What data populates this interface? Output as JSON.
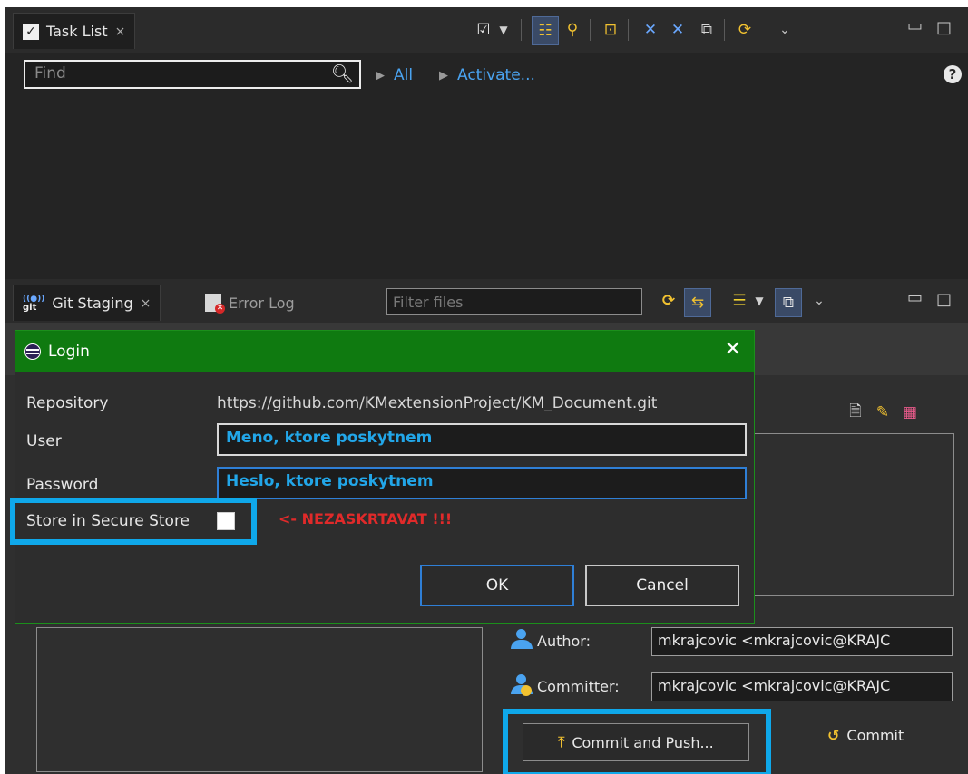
{
  "task_list": {
    "tab_label": "Task List",
    "find_placeholder": "Find",
    "link_all": "All",
    "link_activate": "Activate...",
    "help_glyph": "?"
  },
  "git_staging": {
    "tab_label": "Git Staging",
    "git_icon_text": "git",
    "error_log_tab_label": "Error Log",
    "filter_placeholder": "Filter files",
    "author_label": "Author:",
    "author_value": "mkrajcovic <mkrajcovic@KRAJC",
    "committer_label": "Committer:",
    "committer_value": "mkrajcovic <mkrajcovic@KRAJC",
    "commit_push_label": "Commit and Push...",
    "commit_label": "Commit"
  },
  "login_dialog": {
    "title": "Login",
    "repository_label": "Repository",
    "repository_url": "https://github.com/KMextensionProject/KM_Document.git",
    "user_label": "User",
    "user_value": "Meno, ktore poskytnem",
    "password_label": "Password",
    "password_value": "Heslo, ktore poskytnem",
    "store_label": "Store in Secure Store",
    "warning_text": "<- NEZASKRTAVAT !!!",
    "ok_label": "OK",
    "cancel_label": "Cancel"
  },
  "colors": {
    "dialog_title_bg": "#0f7a10",
    "highlight": "#0fa8ea",
    "warning": "#e02a2a",
    "input_text": "#22a6e8",
    "link": "#4aa3f0"
  }
}
